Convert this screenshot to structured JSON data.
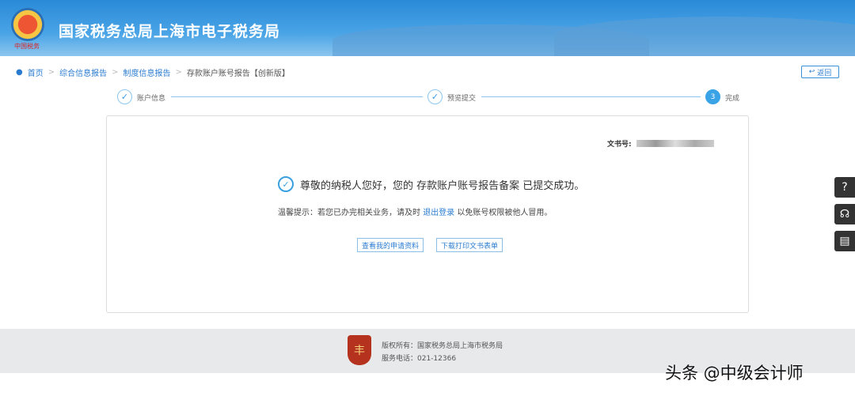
{
  "header": {
    "title": "国家税务总局上海市电子税务局",
    "emblem_text": "中国税务"
  },
  "breadcrumb": [
    "首页",
    "综合信息报告",
    "制度信息报告",
    "存款账户账号报告【创新版】"
  ],
  "back_label": "返回",
  "steps": [
    {
      "label": "账户信息",
      "state": "done"
    },
    {
      "label": "预览提交",
      "state": "done"
    },
    {
      "label": "完成",
      "number": "3",
      "state": "active"
    }
  ],
  "card": {
    "doc_no_label": "文书号:",
    "success_message": "尊敬的纳税人您好，您的 存款账户账号报告备案 已提交成功。",
    "hint_prefix": "温馨提示：若您已办完相关业务，请及时 ",
    "hint_link": "退出登录",
    "hint_suffix": " 以免账号权限被他人冒用。",
    "buttons": [
      "查看我的申请资料",
      "下载打印文书表单"
    ]
  },
  "side_tools": [
    "help",
    "customer-service",
    "manual"
  ],
  "footer": {
    "copyright": "版权所有：国家税务总局上海市税务局",
    "phone": "服务电话：021-12366"
  },
  "watermark": "头条 @中级会计师"
}
